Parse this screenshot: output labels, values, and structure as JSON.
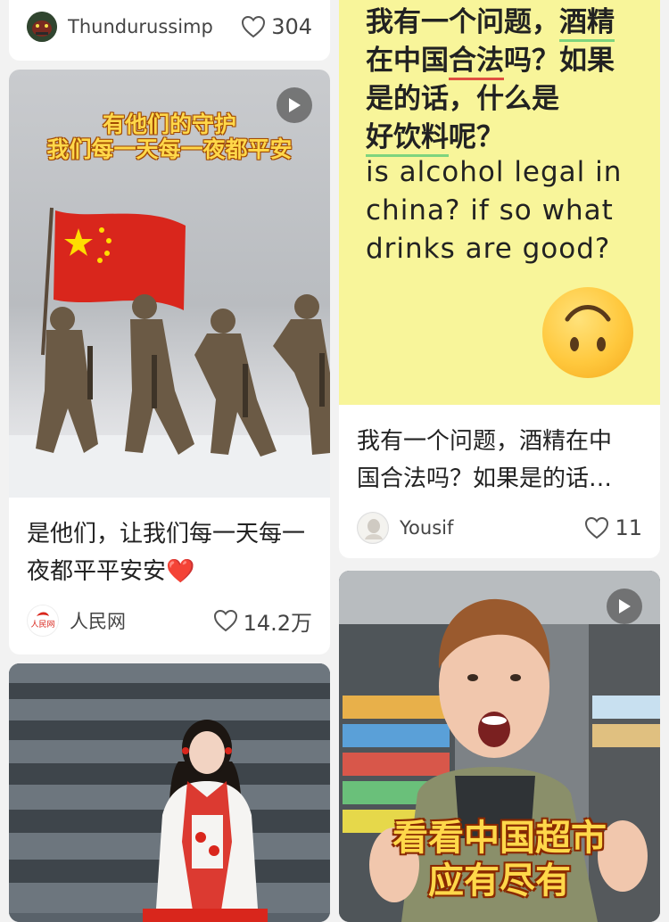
{
  "cards": {
    "top_left": {
      "author": "Thundurussimp",
      "likes": "304"
    },
    "soldiers": {
      "caption_line1": "有他们的守护",
      "caption_line2": "我们每一天每一夜都平安",
      "title": "是他们，让我们每一天每一夜都平平安安❤️",
      "author": "人民网",
      "likes": "14.2万"
    },
    "stairs": {},
    "alcohol": {
      "zh_line1a": "我有一个问题，",
      "zh_line1b": "酒精",
      "zh_line2a": "在中国",
      "zh_line2b": "合法",
      "zh_line2c": "吗？如果",
      "zh_line3": "是的话，什么是",
      "zh_line4a": "好饮料",
      "zh_line4b": "呢？",
      "en_line1": "is alcohol legal in",
      "en_line2": "china? if so what",
      "en_line3": "drinks are good?",
      "emoji": "🙃",
      "title_line1": "我有一个问题，酒精在中",
      "title_line2": "国合法吗？如果是的话…",
      "author": "Yousif",
      "likes": "11"
    },
    "supermarket": {
      "caption_line1": "看看中国超市",
      "caption_line2": "应有尽有"
    }
  },
  "colors": {
    "page_bg": "#f2f2f2",
    "yellow_card_bg": "#f8f59a",
    "caption_yellow": "#ffd84a",
    "underline_green": "#7ed47e",
    "underline_red": "#e05040",
    "heart_outline": "#555555"
  },
  "icons": [
    "heart-icon",
    "play-icon",
    "avatar"
  ]
}
